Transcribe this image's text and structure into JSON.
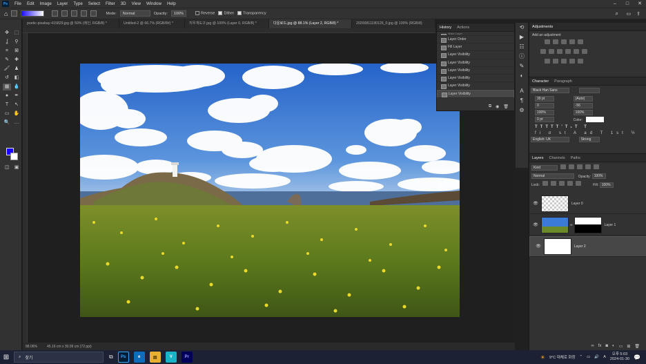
{
  "menubar": {
    "items": [
      "File",
      "Edit",
      "Image",
      "Layer",
      "Type",
      "Select",
      "Filter",
      "3D",
      "View",
      "Window",
      "Help"
    ],
    "logo": "Ps"
  },
  "options": {
    "mode_label": "Mode:",
    "mode_value": "Normal",
    "opacity_label": "Opacity:",
    "opacity_value": "100%",
    "reverse": "Reverse",
    "dither": "Dither",
    "transparency": "Transparency"
  },
  "tabs": [
    {
      "label": "poetic-pixabay-415829.jpg @ 50% (레인, RGB/8) *"
    },
    {
      "label": "Untitled-2 @ 66.7% (RGB/8#) *"
    },
    {
      "label": "지우개도구.jpg @ 100% (Layer 0, RGB/8) *"
    },
    {
      "label": "다운로드.jpg @ 88.1% (Layer 2, RGB/8) *"
    },
    {
      "label": "20200811180126_0.jpg @ 100% (RGB/8)"
    }
  ],
  "status": {
    "zoom": "88.06%",
    "doc": "45.16 cm x 30.09 cm (72 ppi)"
  },
  "history": {
    "tab": "History",
    "tab2": "Actions",
    "items": [
      "Make Layer",
      "Layer Order",
      "Fill Layer",
      "Layer Visibility",
      "Layer Visibility",
      "Layer Visibility",
      "Layer Visibility",
      "Layer Visibility",
      "Layer Visibility"
    ]
  },
  "adjustments": {
    "title": "Adjustments",
    "subtitle": "Add an adjustment"
  },
  "character": {
    "tab": "Character",
    "tab2": "Paragraph",
    "font": "Black Han Sans",
    "size": "39 pt",
    "leading": "(Auto)",
    "kerning": "0",
    "tracking": "-56",
    "vscale": "100%",
    "hscale": "100%",
    "baseline": "0 pt",
    "color_label": "Color:",
    "language": "English: UK",
    "aa": "Strong"
  },
  "layers": {
    "tab": "Layers",
    "tab2": "Channels",
    "tab3": "Paths",
    "kind": "Kind",
    "blend": "Normal",
    "opacity_label": "Opacity:",
    "opacity": "100%",
    "lock_label": "Lock:",
    "fill_label": "Fill:",
    "fill": "100%",
    "list": [
      {
        "name": "Layer 0"
      },
      {
        "name": "Layer 1"
      },
      {
        "name": "Layer 2"
      }
    ]
  },
  "taskbar": {
    "search": "찾기",
    "weather": "9°C 대체로 화창",
    "ime": "A",
    "time": "오후 5:03",
    "date": "2024-01-30"
  },
  "colors": {
    "foreground": "#1a00ff",
    "background": "#ffffff",
    "sky": "#2f6fd6"
  }
}
